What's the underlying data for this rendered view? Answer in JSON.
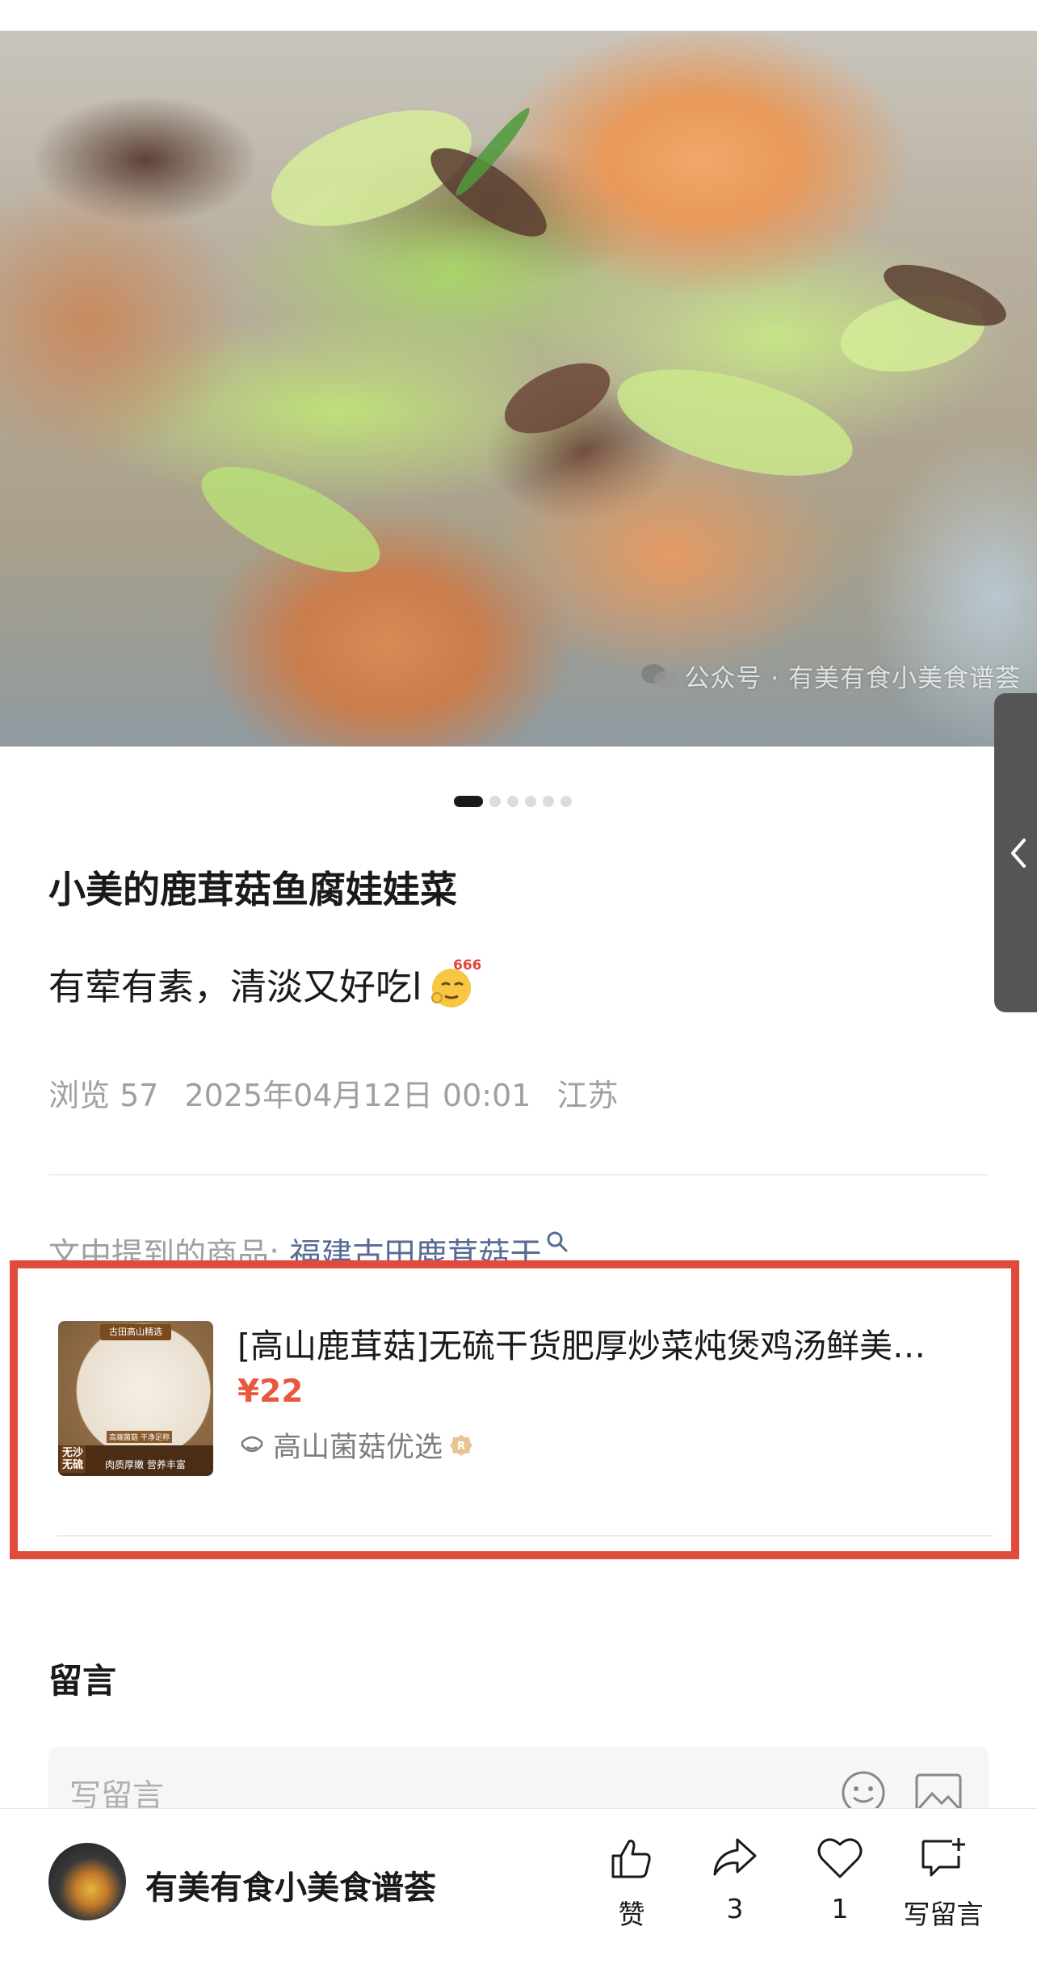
{
  "photo": {
    "watermark": "公众号 · 有美有食小美食谱荟"
  },
  "carousel": {
    "count": 6,
    "active": 0
  },
  "article": {
    "title": "小美的鹿茸菇鱼腐娃娃菜",
    "description": "有荤有素，清淡又好吃l",
    "emoji_label": "666",
    "views": "浏览 57",
    "datetime": "2025年04月12日 00:01",
    "location": "江苏"
  },
  "mentioned": {
    "prefix": "文中提到的商品: ",
    "link": "福建古田鹿茸菇干"
  },
  "product": {
    "thumb_badge": "古田高山精选",
    "thumb_tag1": "无沙\n无硫",
    "thumb_tag2": "肉质厚嫩 营养丰富",
    "thumb_tag3": "高端菌菇 干净足称",
    "title": "[高山鹿茸菇]无硫干货肥厚炒菜炖煲鸡汤鲜美…",
    "price": "¥22",
    "shop": "高山菌菇优选"
  },
  "comments": {
    "title": "留言",
    "placeholder": "写留言"
  },
  "bottom": {
    "account": "有美有食小美食谱荟",
    "like_label": "赞",
    "share_count": "3",
    "favorite_count": "1",
    "comment_label": "写留言"
  },
  "colors": {
    "highlight_border": "#e04b3c",
    "price": "#e8593f",
    "link": "#576b95"
  }
}
